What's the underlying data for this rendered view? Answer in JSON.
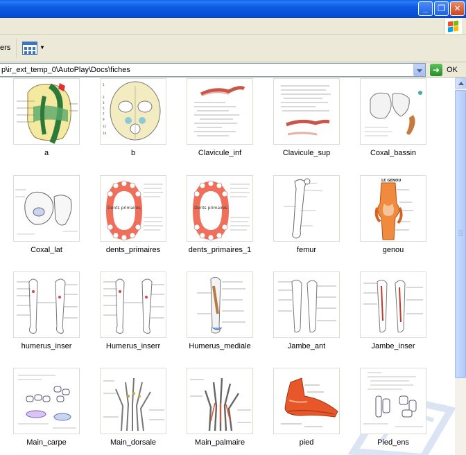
{
  "window": {
    "buttons": [
      "minimize",
      "maximize",
      "close"
    ],
    "colors": {
      "titlebar": "#0a5fe8",
      "chrome": "#ece9d8",
      "close": "#c9451f"
    }
  },
  "toolbar": {
    "folders_label": "ers",
    "views_icon": "views-icon"
  },
  "address": {
    "path": "p\\ir_ext_temp_0\\AutoPlay\\Docs\\fiches",
    "go_label": "OK"
  },
  "files": [
    {
      "name": "a"
    },
    {
      "name": "b"
    },
    {
      "name": "Clavicule_inf"
    },
    {
      "name": "Clavicule_sup"
    },
    {
      "name": "Coxal_bassin"
    },
    {
      "name": "Coxal_lat"
    },
    {
      "name": "dents_primaires",
      "thumb_text": "Dents primaires"
    },
    {
      "name": "dents_primaires_1",
      "thumb_text": "Dents primaires"
    },
    {
      "name": "femur"
    },
    {
      "name": "genou",
      "thumb_text": "LE GENOU"
    },
    {
      "name": "humerus_inser"
    },
    {
      "name": "Humerus_inserr"
    },
    {
      "name": "Humerus_mediale"
    },
    {
      "name": "Jambe_ant"
    },
    {
      "name": "Jambe_inser"
    },
    {
      "name": "Main_carpe"
    },
    {
      "name": "Main_dorsale"
    },
    {
      "name": "Main_palmaire"
    },
    {
      "name": "pied"
    },
    {
      "name": "Pied_ens"
    }
  ]
}
